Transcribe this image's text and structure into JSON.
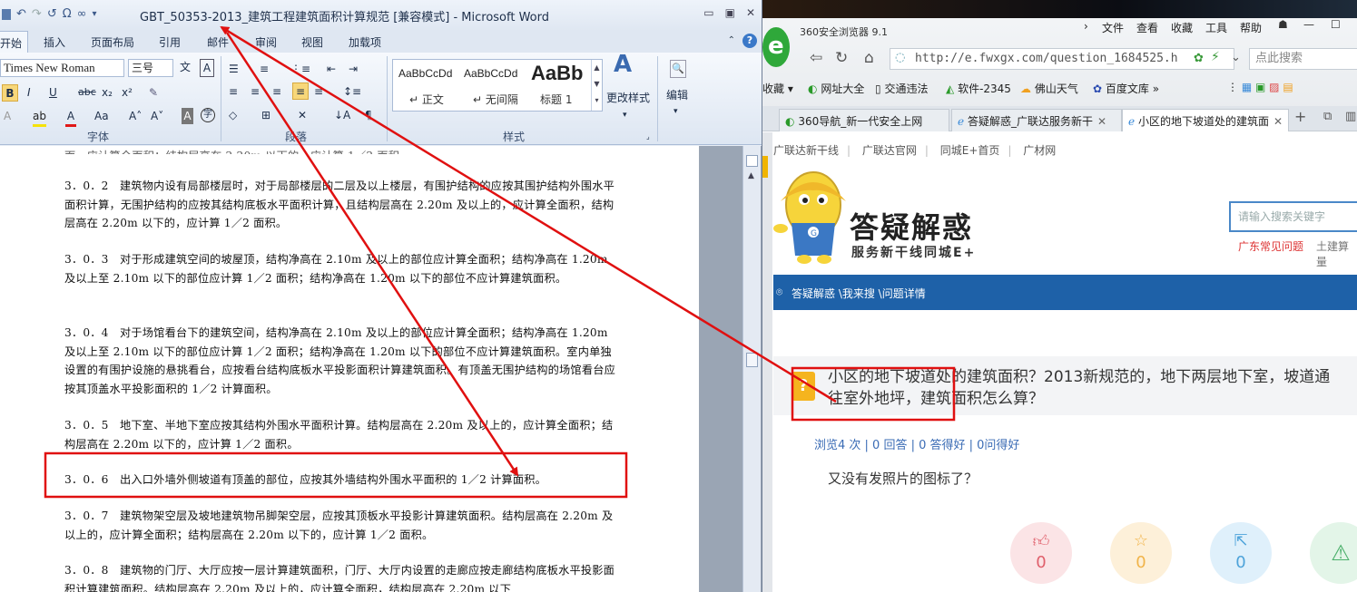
{
  "word": {
    "title": "GBT_50353-2013_建筑工程建筑面积计算规范 [兼容模式] - Microsoft Word",
    "qat_icons": [
      "undo-icon",
      "redo-icon",
      "omega-icon",
      "infinity-icon"
    ],
    "tabs": [
      {
        "label": "开始"
      },
      {
        "label": "插入"
      },
      {
        "label": "页面布局"
      },
      {
        "label": "引用"
      },
      {
        "label": "邮件"
      },
      {
        "label": "审阅"
      },
      {
        "label": "视图"
      },
      {
        "label": "加载项"
      }
    ],
    "ribbon": {
      "font_name": "Times New Roman",
      "font_size": "三号",
      "group_font": "字体",
      "group_paragraph": "段落",
      "group_styles": "样式",
      "styles": [
        {
          "preview": "AaBbCcDd",
          "name": "↵ 正文"
        },
        {
          "preview": "AaBbCcDd",
          "name": "↵ 无间隔"
        },
        {
          "preview": "AaBb",
          "name": "标题 1"
        }
      ],
      "change_styles": "更改样式",
      "edit": "编辑",
      "bold": "B",
      "italic": "I",
      "underline": "U",
      "strike": "abc",
      "subscript": "x₂",
      "superscript": "x²",
      "font_color_letter": "A",
      "change_case": "Aa",
      "grow_font": "A˄",
      "shrink_font": "A˅"
    },
    "paragraphs": [
      {
        "text": "3．0．2　建筑物内设有局部楼层时，对于局部楼层的二层及以上楼层，有围护结构的应按其围护结构外围水平面积计算，无围护结构的应按其结构底板水平面积计算，且结构层高在 2.20m 及以上的，应计算全面积，结构层高在 2.20m 以下的，应计算 1／2 面积。"
      },
      {
        "text": "3．0．3　对于形成建筑空间的坡屋顶，结构净高在 2.10m 及以上的部位应计算全面积；结构净高在 1.20m 及以上至 2.10m 以下的部位应计算 1／2 面积；结构净高在 1.20m 以下的部位不应计算建筑面积。"
      },
      {
        "text": "3．0．4　对于场馆看台下的建筑空间，结构净高在 2.10m 及以上的部位应计算全面积；结构净高在 1.20m 及以上至 2.10m 以下的部位应计算 1／2 面积；结构净高在 1.20m 以下的部位不应计算建筑面积。室内单独设置的有围护设施的悬挑看台，应按看台结构底板水平投影面积计算建筑面积。有顶盖无围护结构的场馆看台应按其顶盖水平投影面积的 1／2 计算面积。"
      },
      {
        "text": "3．0．5　地下室、半地下室应按其结构外围水平面积计算。结构层高在 2.20m 及以上的，应计算全面积；结构层高在 2.20m 以下的，应计算 1／2 面积。"
      },
      {
        "text": "3．0．6　出入口外墙外侧坡道有顶盖的部位，应按其外墙结构外围水平面积的 1／2 计算面积。"
      },
      {
        "text": "3．0．7　建筑物架空层及坡地建筑物吊脚架空层，应按其顶板水平投影计算建筑面积。结构层高在 2.20m 及以上的，应计算全面积；结构层高在 2.20m 以下的，应计算 1／2 面积。"
      },
      {
        "text": "3．0．8　建筑物的门厅、大厅应按一层计算建筑面积，门厅、大厅内设置的走廊应按走廊结构底板水平投影面积计算建筑面积。结构层高在 2.20m 及以上的，应计算全面积，结构层高在 2.20m 以下"
      }
    ]
  },
  "browser": {
    "app_name": "360安全浏览器 9.1",
    "menu": [
      "文件",
      "查看",
      "收藏",
      "工具",
      "帮助"
    ],
    "url": "http://e.fwxgx.com/question_1684525.h",
    "search_placeholder": "点此搜索",
    "bookmarks": [
      "收藏",
      "网址大全",
      "交通违法",
      "软件-2345",
      "佛山天气",
      "百度文库"
    ],
    "tabs": [
      {
        "label": "360导航_新一代安全上网"
      },
      {
        "label": "答疑解惑_广联达服务新干"
      },
      {
        "label": "小区的地下坡道处的建筑面"
      }
    ],
    "top_links": [
      "广联达新干线",
      "广联达官网",
      "同城E+首页",
      "广材网"
    ],
    "site_title": "答疑解惑",
    "site_subtitle": "服务新干线同城E+",
    "site_search_placeholder": "请输入搜索关键字",
    "site_link_common": "广东常见问题",
    "site_link_other": "土建算量",
    "breadcrumb": "答疑解惑 \\我来搜 \\问题详情",
    "question_title": "小区的地下坡道处的建筑面积？2013新规范的，地下两层地下室，坡道通往室外地坪，建筑面积怎么算？",
    "question_stats": "浏览4 次 | 0 回答 | 0 答得好 | 0问得好",
    "question_body": "又没有发照片的图标了？",
    "actions": [
      {
        "name": "like",
        "count": "0"
      },
      {
        "name": "favorite",
        "count": "0"
      },
      {
        "name": "share",
        "count": "0"
      },
      {
        "name": "report",
        "count": ""
      }
    ]
  },
  "annotation": {
    "color": "#e01010"
  }
}
